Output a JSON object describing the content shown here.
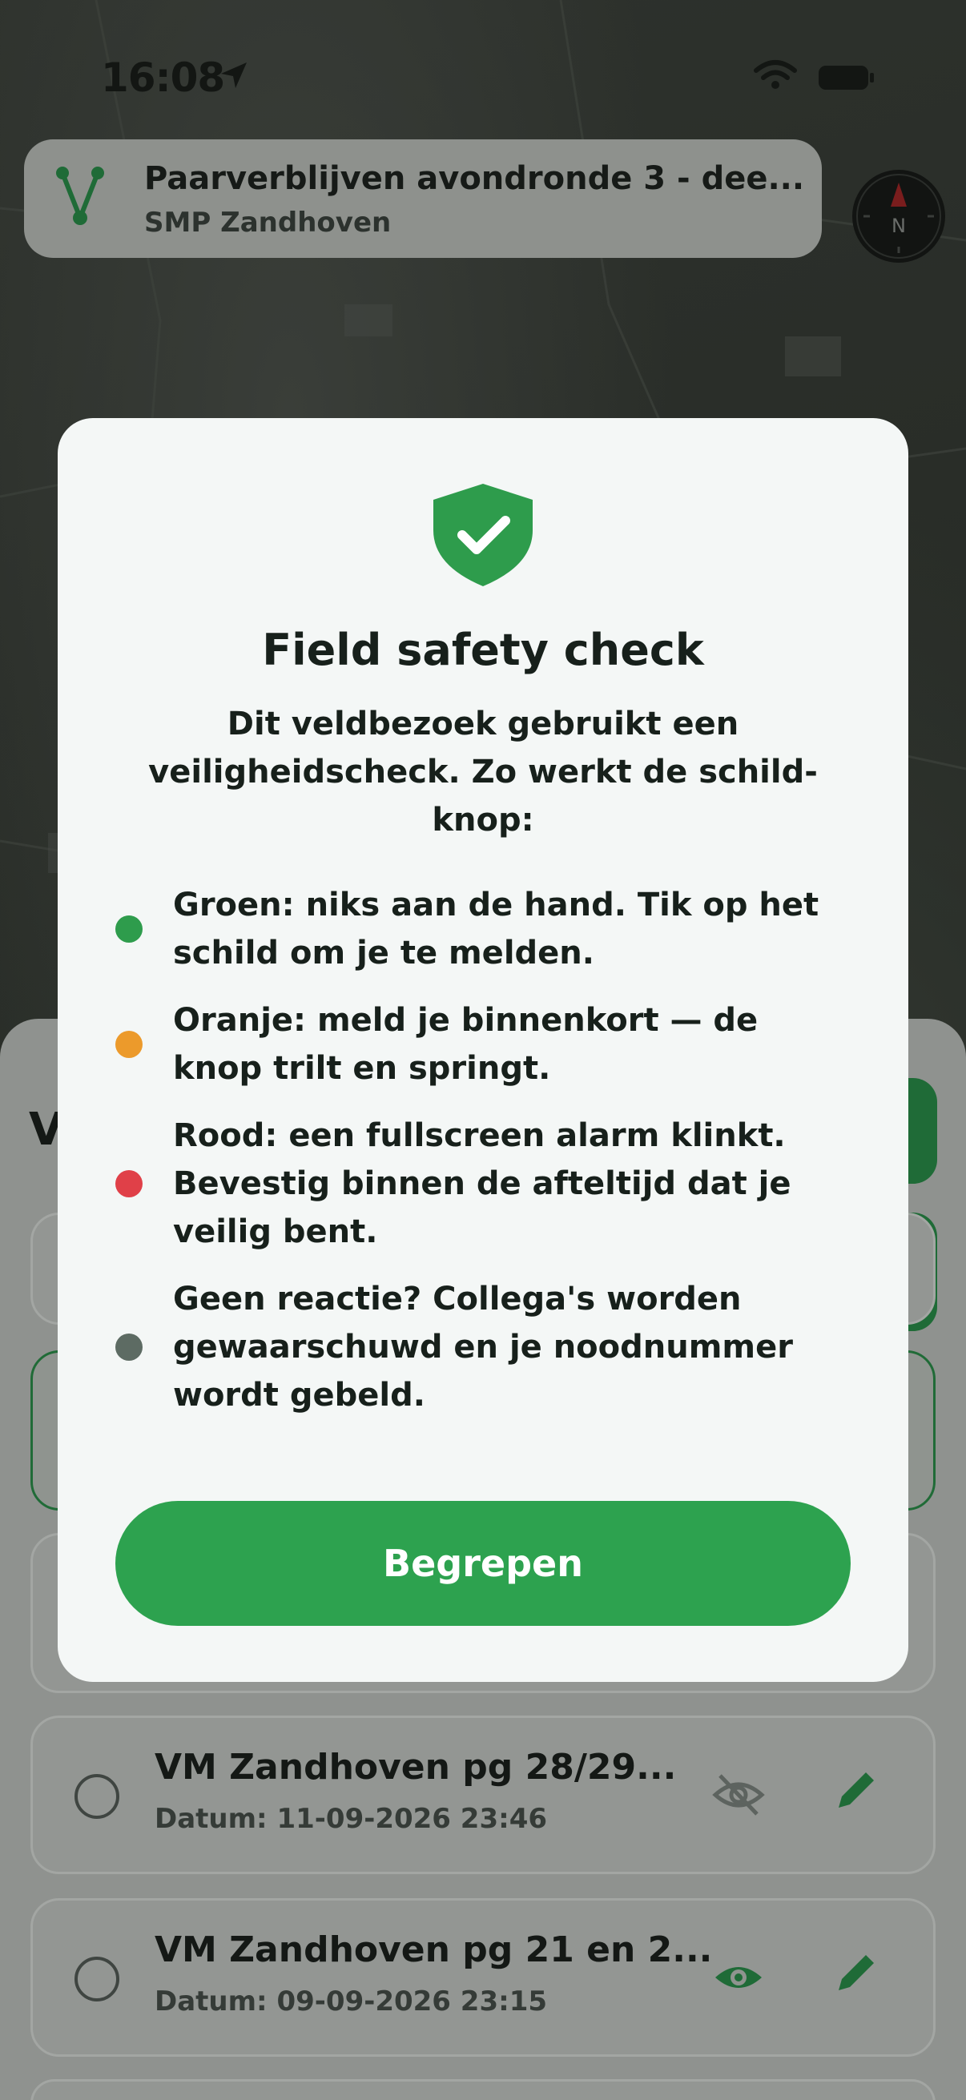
{
  "status_bar": {
    "time": "16:08",
    "location_icon": "location-arrow-icon",
    "wifi_icon": "wifi-icon",
    "battery_icon": "battery-icon"
  },
  "route_card": {
    "icon": "route-icon",
    "title": "Paarverblijven avondronde 3 - dee...",
    "subtitle": "SMP Zandhoven"
  },
  "compass": {
    "icon": "compass-icon",
    "letter": "N"
  },
  "sheet": {
    "heading_partial": "V",
    "cards": [
      {
        "title": "VM Zandhoven pg 28/29...",
        "date": "Datum: 11-09-2026 23:46",
        "visibility_icon": "eye-off-icon",
        "edit_icon": "pencil-icon"
      },
      {
        "title": "VM Zandhoven pg 21 en 2...",
        "date": "Datum: 09-09-2026 23:15",
        "visibility_icon": "eye-icon",
        "edit_icon": "pencil-icon"
      }
    ]
  },
  "modal": {
    "icon": "shield-check-icon",
    "title": "Field safety check",
    "intro": [
      "Dit veldbezoek gebruikt een",
      "veiligheidscheck. Zo werkt de schild-",
      "knop:"
    ],
    "legend": [
      {
        "color": "#2e9c4c",
        "lines": [
          "Groen: niks aan de hand. Tik op het",
          "schild om je te melden."
        ]
      },
      {
        "color": "#ec9a2b",
        "lines": [
          "Oranje: meld je binnenkort — de",
          "knop trilt en springt."
        ]
      },
      {
        "color": "#e04048",
        "lines": [
          "Rood: een fullscreen alarm klinkt.",
          "Bevestig binnen de afteltijd dat je",
          "veilig bent."
        ]
      },
      {
        "color": "#5d6b63",
        "lines": [
          "Geen reactie? Collega's worden",
          "gewaarschuwd en je noodnummer",
          "wordt gebeld."
        ]
      }
    ],
    "button_label": "Begrepen"
  },
  "colors": {
    "accent_green": "#2da24f",
    "dim_overlay": "#8f928f"
  }
}
